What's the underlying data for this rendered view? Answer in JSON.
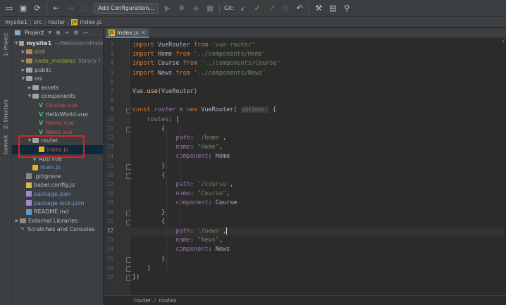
{
  "toolbar": {
    "run_config_label": "Add Configuration...",
    "git_label": "Git:"
  },
  "navbar": {
    "crumbs": [
      "mysite1",
      "src",
      "router",
      "index.js"
    ]
  },
  "stripe": {
    "project_tab": "1: Project",
    "structure_tab": "Z: Structure",
    "commit_tab": "Commit"
  },
  "project": {
    "header_label": "Project",
    "tree": [
      {
        "label": "mysite1",
        "suffix": "~/WebstormProje",
        "indent": 0,
        "type": "folder",
        "arrow": "▼",
        "style": "bold"
      },
      {
        "label": "dist",
        "suffix": "",
        "indent": 1,
        "type": "folder-brown",
        "arrow": "▶",
        "style": "olive"
      },
      {
        "label": "node_modules",
        "suffix": "library r",
        "indent": 1,
        "type": "folder-brown",
        "arrow": "▶",
        "style": "olive"
      },
      {
        "label": "public",
        "suffix": "",
        "indent": 1,
        "type": "folder",
        "arrow": "▶",
        "style": ""
      },
      {
        "label": "src",
        "suffix": "",
        "indent": 1,
        "type": "folder",
        "arrow": "▼",
        "style": ""
      },
      {
        "label": "assets",
        "suffix": "",
        "indent": 2,
        "type": "folder",
        "arrow": "▶",
        "style": ""
      },
      {
        "label": "components",
        "suffix": "",
        "indent": 2,
        "type": "folder",
        "arrow": "▼",
        "style": ""
      },
      {
        "label": "Course.vue",
        "suffix": "",
        "indent": 3,
        "type": "vue",
        "arrow": "",
        "style": "red"
      },
      {
        "label": "HelloWorld.vue",
        "suffix": "",
        "indent": 3,
        "type": "vue",
        "arrow": "",
        "style": ""
      },
      {
        "label": "Home.vue",
        "suffix": "",
        "indent": 3,
        "type": "vue",
        "arrow": "",
        "style": "red"
      },
      {
        "label": "News.vue",
        "suffix": "",
        "indent": 3,
        "type": "vue",
        "arrow": "",
        "style": "red"
      },
      {
        "label": "router",
        "suffix": "",
        "indent": 2,
        "type": "folder",
        "arrow": "▼",
        "style": ""
      },
      {
        "label": "index.js",
        "suffix": "",
        "indent": 3,
        "type": "js",
        "arrow": "",
        "style": "red",
        "selected": true
      },
      {
        "label": "App.vue",
        "suffix": "",
        "indent": 2,
        "type": "vue",
        "arrow": "",
        "style": ""
      },
      {
        "label": "main.js",
        "suffix": "",
        "indent": 2,
        "type": "js",
        "arrow": "",
        "style": "blue"
      },
      {
        "label": ".gitignore",
        "suffix": "",
        "indent": 1,
        "type": "git",
        "arrow": "",
        "style": ""
      },
      {
        "label": "babel.config.js",
        "suffix": "",
        "indent": 1,
        "type": "babel",
        "arrow": "",
        "style": ""
      },
      {
        "label": "package.json",
        "suffix": "",
        "indent": 1,
        "type": "json",
        "arrow": "",
        "style": "blue"
      },
      {
        "label": "package-lock.json",
        "suffix": "",
        "indent": 1,
        "type": "json",
        "arrow": "",
        "style": "blue"
      },
      {
        "label": "README.md",
        "suffix": "",
        "indent": 1,
        "type": "md",
        "arrow": "",
        "style": ""
      },
      {
        "label": "External Libraries",
        "suffix": "",
        "indent": 0,
        "type": "lib",
        "arrow": "▶",
        "style": ""
      },
      {
        "label": "Scratches and Consoles",
        "suffix": "",
        "indent": 0,
        "type": "scratch",
        "arrow": "",
        "style": ""
      }
    ]
  },
  "editor": {
    "tab_label": "index.js",
    "current_line": 22,
    "lines": [
      {
        "n": 2,
        "code": [
          [
            "kw",
            "import "
          ],
          [
            "",
            "VueRouter "
          ],
          [
            "kw",
            "from "
          ],
          [
            "str",
            "'vue-router'"
          ]
        ]
      },
      {
        "n": 3,
        "code": [
          [
            "kw",
            "import "
          ],
          [
            "",
            "Home "
          ],
          [
            "kw",
            "from "
          ],
          [
            "str",
            "'../components/Home'"
          ]
        ]
      },
      {
        "n": 4,
        "code": [
          [
            "kw",
            "import "
          ],
          [
            "",
            "Course "
          ],
          [
            "kw",
            "from "
          ],
          [
            "str",
            "'../components/Course'"
          ]
        ]
      },
      {
        "n": 5,
        "code": [
          [
            "kw",
            "import "
          ],
          [
            "",
            "News "
          ],
          [
            "kw",
            "from "
          ],
          [
            "str",
            "'../components/News'"
          ]
        ]
      },
      {
        "n": 6,
        "code": []
      },
      {
        "n": 7,
        "code": [
          [
            "",
            "Vue."
          ],
          [
            "fn",
            "use"
          ],
          [
            "",
            "(VueRouter)"
          ]
        ]
      },
      {
        "n": 8,
        "code": []
      },
      {
        "n": 9,
        "code": [
          [
            "kw",
            "const "
          ],
          [
            "it",
            "router"
          ],
          [
            "",
            " = "
          ],
          [
            "kw",
            "new "
          ],
          [
            "",
            "VueRouter( "
          ],
          [
            "hint",
            "options:"
          ],
          [
            "",
            " {"
          ]
        ]
      },
      {
        "n": 10,
        "code": [
          [
            "",
            "    "
          ],
          [
            "prop",
            "routes"
          ],
          [
            "",
            ": ["
          ]
        ]
      },
      {
        "n": 11,
        "code": [
          [
            "",
            "        {"
          ]
        ]
      },
      {
        "n": 12,
        "code": [
          [
            "",
            "            "
          ],
          [
            "prop",
            "path"
          ],
          [
            "",
            ": "
          ],
          [
            "str",
            "'/home'"
          ],
          [
            "",
            ","
          ]
        ]
      },
      {
        "n": 13,
        "code": [
          [
            "",
            "            "
          ],
          [
            "prop",
            "name"
          ],
          [
            "",
            ": "
          ],
          [
            "str",
            "\"Home\""
          ],
          [
            "",
            ","
          ]
        ]
      },
      {
        "n": 14,
        "code": [
          [
            "",
            "            "
          ],
          [
            "prop",
            "component"
          ],
          [
            "",
            ": Home"
          ]
        ]
      },
      {
        "n": 15,
        "code": [
          [
            "",
            "        },"
          ]
        ]
      },
      {
        "n": 16,
        "code": [
          [
            "",
            "        {"
          ]
        ]
      },
      {
        "n": 17,
        "code": [
          [
            "",
            "            "
          ],
          [
            "prop",
            "path"
          ],
          [
            "",
            ": "
          ],
          [
            "str",
            "'/course'"
          ],
          [
            "",
            ","
          ]
        ]
      },
      {
        "n": 18,
        "code": [
          [
            "",
            "            "
          ],
          [
            "prop",
            "name"
          ],
          [
            "",
            ": "
          ],
          [
            "str",
            "\"Course\""
          ],
          [
            "",
            ","
          ]
        ]
      },
      {
        "n": 19,
        "code": [
          [
            "",
            "            "
          ],
          [
            "prop",
            "component"
          ],
          [
            "",
            ": Course"
          ]
        ]
      },
      {
        "n": 20,
        "code": [
          [
            "",
            "        },"
          ]
        ]
      },
      {
        "n": 21,
        "code": [
          [
            "",
            "        {"
          ]
        ]
      },
      {
        "n": 22,
        "code": [
          [
            "",
            "            "
          ],
          [
            "prop",
            "path"
          ],
          [
            "",
            ": "
          ],
          [
            "str",
            "'/news'"
          ],
          [
            "",
            ","
          ],
          [
            "caret",
            ""
          ]
        ]
      },
      {
        "n": 23,
        "code": [
          [
            "",
            "            "
          ],
          [
            "prop",
            "name"
          ],
          [
            "",
            ": "
          ],
          [
            "str",
            "\"News\""
          ],
          [
            "",
            ","
          ]
        ]
      },
      {
        "n": 24,
        "code": [
          [
            "",
            "            "
          ],
          [
            "prop",
            "component"
          ],
          [
            "",
            ": News"
          ]
        ]
      },
      {
        "n": 25,
        "code": [
          [
            "",
            "        },"
          ]
        ]
      },
      {
        "n": 26,
        "code": [
          [
            "",
            "    ]"
          ]
        ]
      },
      {
        "n": 27,
        "code": [
          [
            "",
            "})"
          ]
        ]
      }
    ]
  },
  "breadcrumb": {
    "items": [
      "router",
      "routes"
    ]
  },
  "colors": {
    "highlight_box": "#e02020",
    "editor_bg": "#2b2b2b",
    "keyword": "#cc7832",
    "string": "#6a8759"
  }
}
